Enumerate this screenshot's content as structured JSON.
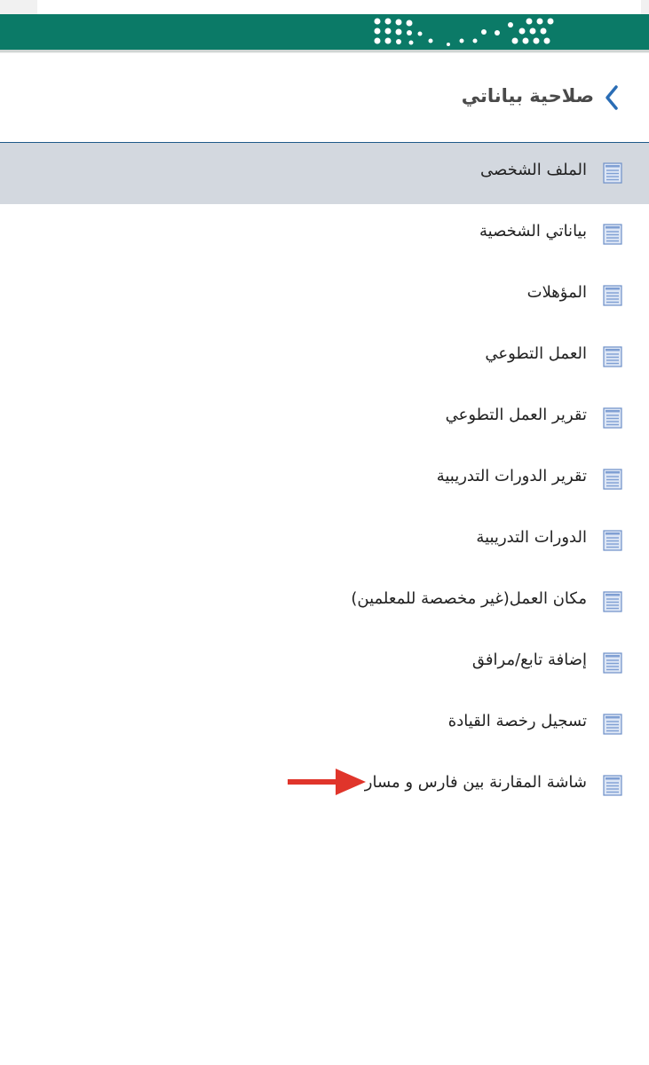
{
  "header": {
    "section_title": "صلاحية بياناتي"
  },
  "menu": {
    "items": [
      {
        "label": "الملف الشخصى",
        "active": true
      },
      {
        "label": "بياناتي الشخصية"
      },
      {
        "label": "المؤهلات"
      },
      {
        "label": "العمل التطوعي"
      },
      {
        "label": "تقرير العمل التطوعي"
      },
      {
        "label": "تقرير الدورات التدريبية"
      },
      {
        "label": "الدورات التدريبية"
      },
      {
        "label": "مكان العمل(غير مخصصة للمعلمين)"
      },
      {
        "label": "إضافة تابع/مرافق"
      },
      {
        "label": "تسجيل رخصة القيادة"
      },
      {
        "label": "شاشة المقارنة بين فارس و مسار"
      }
    ]
  },
  "icons": {
    "back": "chevron-left-icon",
    "item": "document-icon",
    "pointer": "red-arrow-icon"
  },
  "colors": {
    "brand_green": "#0b7a67",
    "active_row": "#d3d8df",
    "divider_blue": "#1f5a8a",
    "chevron_blue": "#2a6db5",
    "arrow_red": "#e0352b"
  }
}
